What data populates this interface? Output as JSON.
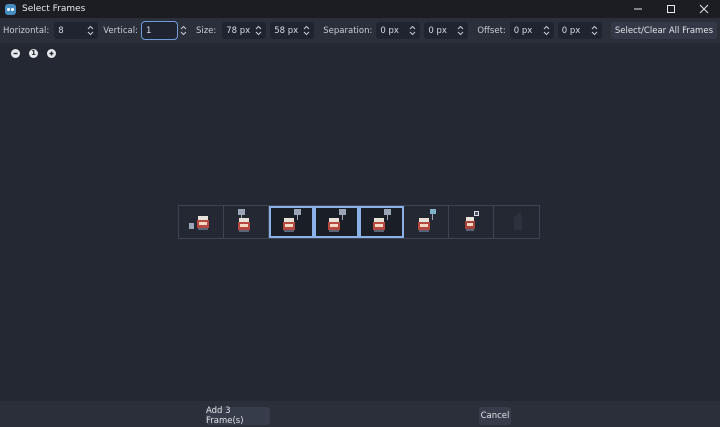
{
  "window": {
    "title": "Select Frames",
    "minimize_icon": "minimize-icon",
    "maximize_icon": "maximize-icon",
    "close_icon": "close-icon"
  },
  "toolbar": {
    "horizontal_label": "Horizontal:",
    "horizontal_value": "8",
    "vertical_label": "Vertical:",
    "vertical_value": "1",
    "size_label": "Size:",
    "size_x": "78 px",
    "size_y": "58 px",
    "separation_label": "Separation:",
    "separation_x": "0 px",
    "separation_y": "0 px",
    "offset_label": "Offset:",
    "offset_x": "0 px",
    "offset_y": "0 px",
    "select_clear_label": "Select/Clear All Frames"
  },
  "zoom": {
    "zoom_out_icon": "zoom-out-icon",
    "zoom_reset_label": "1",
    "zoom_in_icon": "zoom-in-icon"
  },
  "frames": {
    "count": 8,
    "selected_indices": [
      2,
      3,
      4
    ]
  },
  "footer": {
    "add_label": "Add 3 Frame(s)",
    "cancel_label": "Cancel"
  },
  "colors": {
    "background": "#232833",
    "toolbar": "#2a2f3a",
    "selection": "#8ab2e9",
    "accent": "#478cbf"
  }
}
